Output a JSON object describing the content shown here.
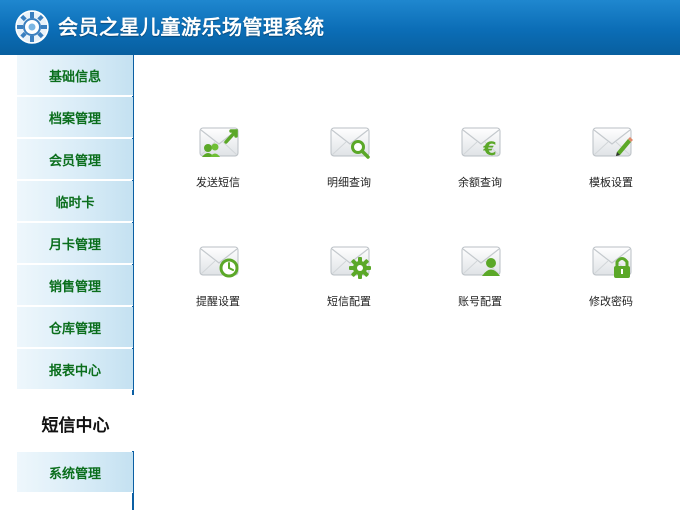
{
  "app": {
    "title": "会员之星儿童游乐场管理系统",
    "logo_icon": "gear-logo-icon"
  },
  "colors": {
    "header": "#0b6db6",
    "nav_text": "#0a6e1c",
    "icon_green": "#5ba828",
    "sidebar_border": "#0b5fa3"
  },
  "sidebar": {
    "items": [
      {
        "label": "基础信息"
      },
      {
        "label": "档案管理"
      },
      {
        "label": "会员管理"
      },
      {
        "label": "临时卡"
      },
      {
        "label": "月卡管理"
      },
      {
        "label": "销售管理"
      },
      {
        "label": "仓库管理"
      },
      {
        "label": "报表中心"
      }
    ],
    "active": {
      "label": "短信中心"
    },
    "after": [
      {
        "label": "系统管理"
      }
    ]
  },
  "main": {
    "tiles": [
      {
        "label": "发送短信",
        "icon": "send-sms-icon"
      },
      {
        "label": "明细查询",
        "icon": "detail-search-icon"
      },
      {
        "label": "余额查询",
        "icon": "balance-euro-icon"
      },
      {
        "label": "模板设置",
        "icon": "template-edit-icon"
      },
      {
        "label": "提醒设置",
        "icon": "reminder-clock-icon"
      },
      {
        "label": "短信配置",
        "icon": "sms-config-gear-icon"
      },
      {
        "label": "账号配置",
        "icon": "account-user-icon"
      },
      {
        "label": "修改密码",
        "icon": "password-lock-icon"
      }
    ]
  }
}
